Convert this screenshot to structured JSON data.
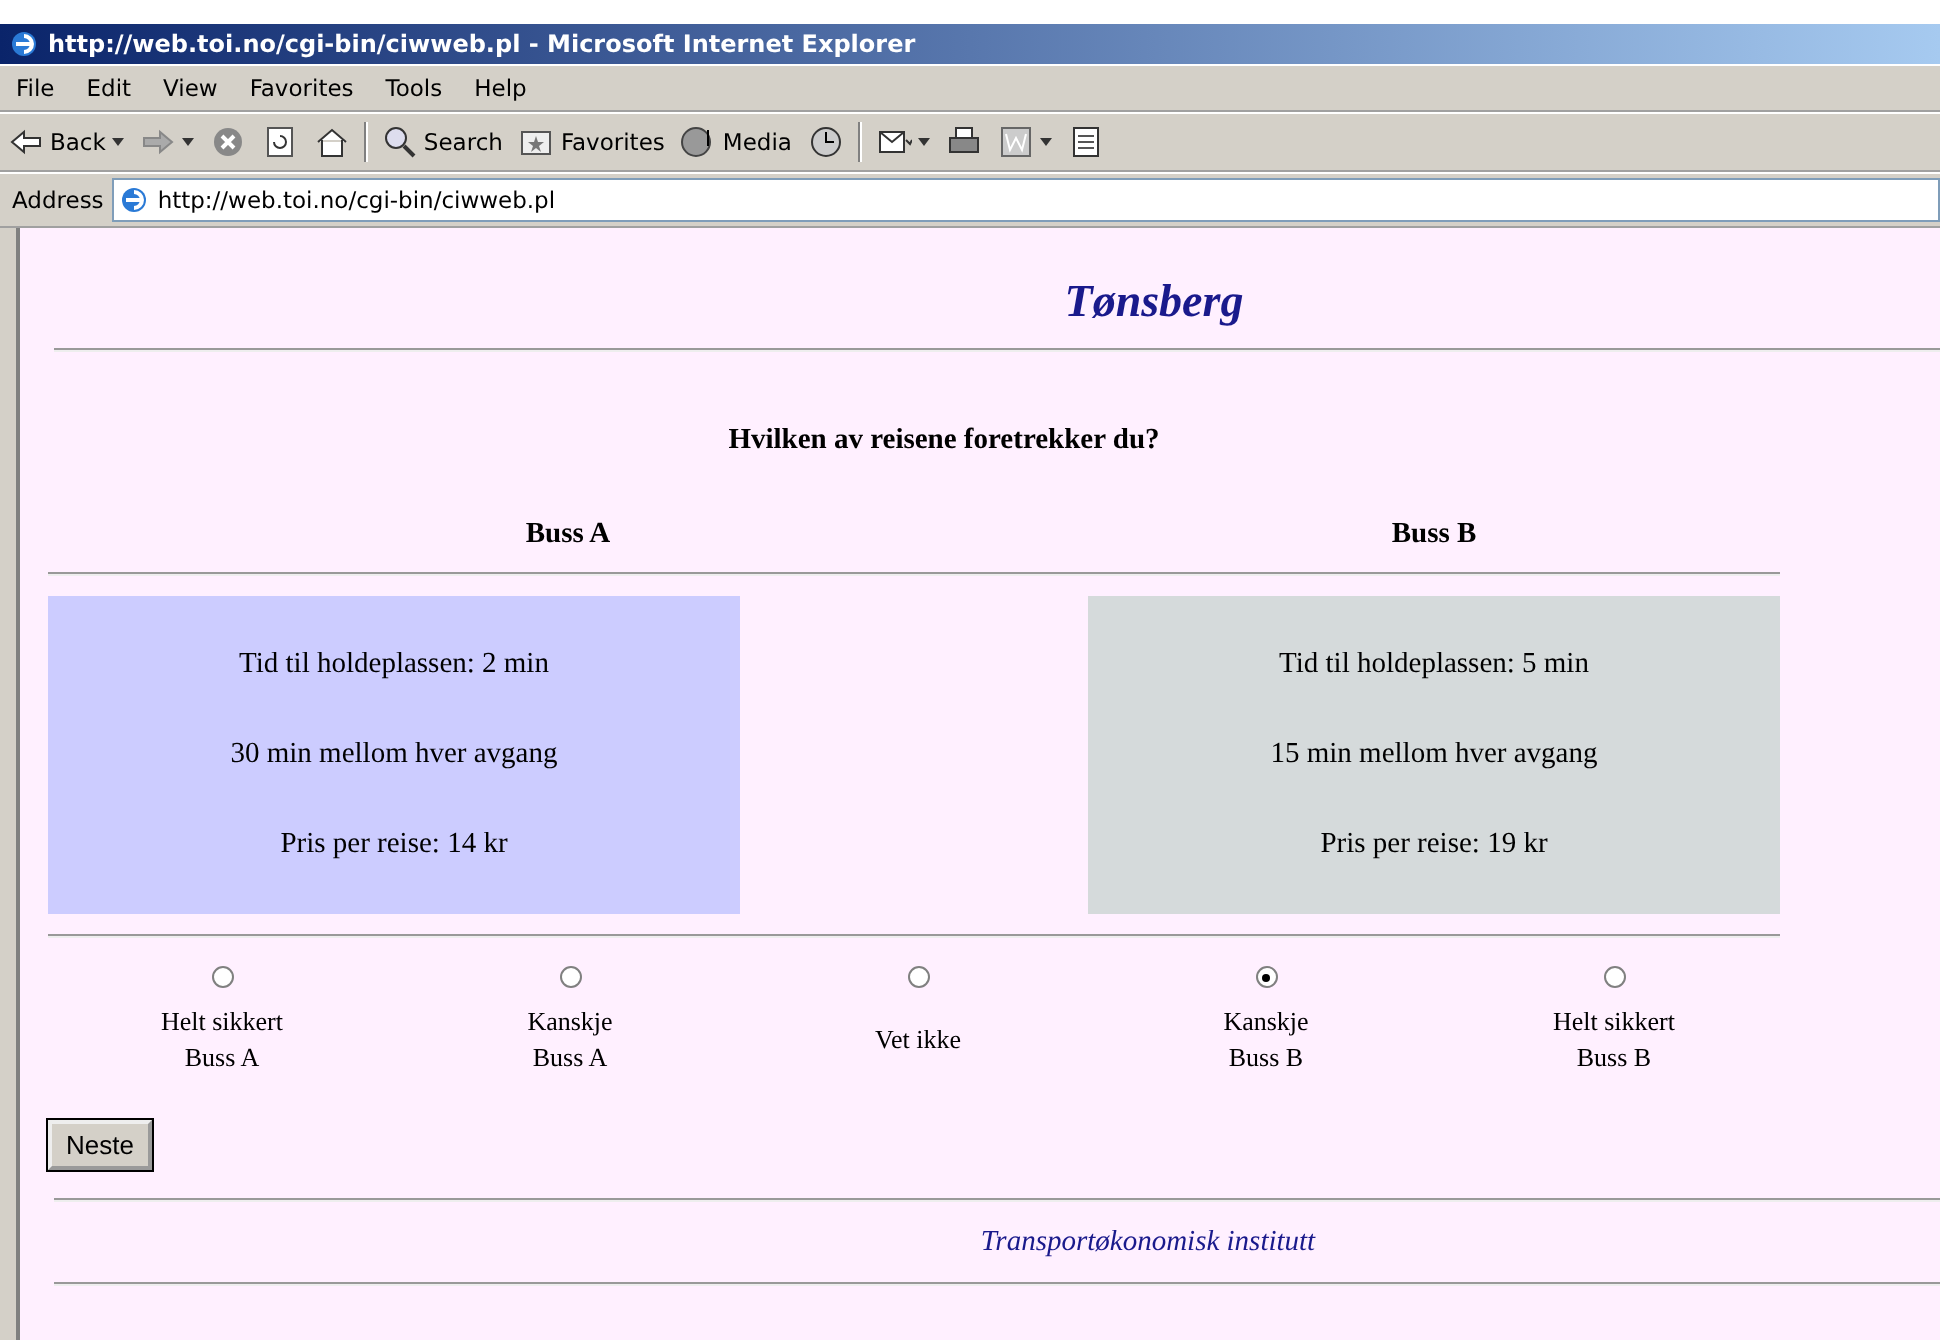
{
  "window": {
    "title": "http://web.toi.no/cgi-bin/ciwweb.pl - Microsoft Internet Explorer"
  },
  "menu": [
    "File",
    "Edit",
    "View",
    "Favorites",
    "Tools",
    "Help"
  ],
  "toolbar": [
    {
      "kind": "back",
      "label": "Back"
    },
    {
      "kind": "forward"
    },
    {
      "kind": "stop"
    },
    {
      "kind": "refresh"
    },
    {
      "kind": "home"
    },
    {
      "kind": "search",
      "label": "Search"
    },
    {
      "kind": "favorites",
      "label": "Favorites"
    },
    {
      "kind": "media",
      "label": "Media"
    },
    {
      "kind": "history"
    },
    {
      "kind": "mail"
    },
    {
      "kind": "print"
    },
    {
      "kind": "edit"
    },
    {
      "kind": "discuss"
    }
  ],
  "address": {
    "label": "Address",
    "value": "http://web.toi.no/cgi-bin/ciwweb.pl"
  },
  "page": {
    "heading": "Tønsberg",
    "question": "Hvilken av reisene foretrekker du?",
    "options": [
      {
        "name": "Buss A",
        "color": "#ccccff",
        "lines": [
          "Tid til holdeplassen: 2 min",
          "30 min mellom hver avgang",
          "Pris per reise: 14 kr"
        ]
      },
      {
        "name": "Buss B",
        "color": "#d5dadb",
        "lines": [
          "Tid til holdeplassen: 5 min",
          "15 min mellom hver avgang",
          "Pris per reise: 19 kr"
        ]
      }
    ],
    "choices": [
      {
        "lines": [
          "Helt sikkert",
          "Buss A"
        ],
        "selected": false
      },
      {
        "lines": [
          "Kanskje",
          "Buss A"
        ],
        "selected": false
      },
      {
        "lines": [
          "Vet ikke"
        ],
        "selected": false
      },
      {
        "lines": [
          "Kanskje",
          "Buss B"
        ],
        "selected": true
      },
      {
        "lines": [
          "Helt sikkert",
          "Buss B"
        ],
        "selected": false
      }
    ],
    "button": "Neste",
    "footer": "Transportøkonomisk institutt"
  }
}
